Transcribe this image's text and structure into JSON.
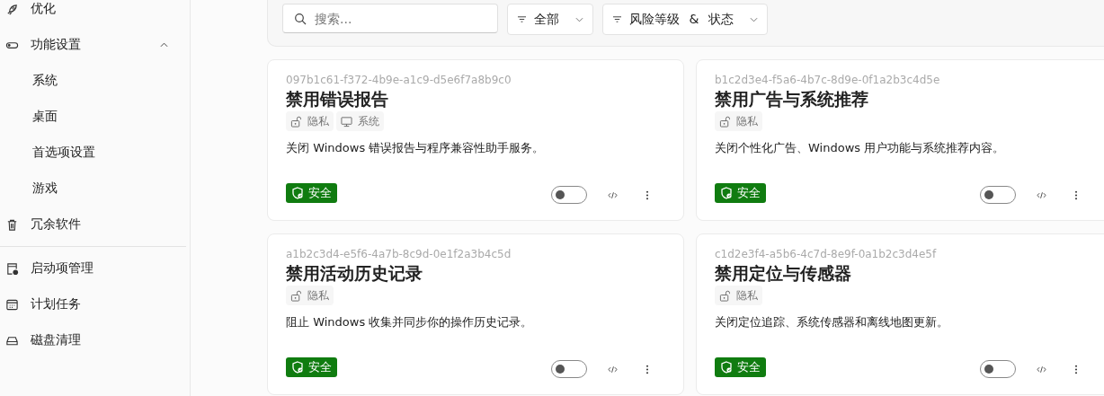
{
  "sidebar": {
    "groups": [
      [
        {
          "label": "优化"
        },
        {
          "label": "功能设置",
          "expanded": true,
          "children": [
            {
              "label": "系统"
            },
            {
              "label": "桌面"
            },
            {
              "label": "首选项设置"
            },
            {
              "label": "游戏"
            }
          ]
        },
        {
          "label": "冗余软件"
        }
      ],
      [
        {
          "label": "启动项管理"
        },
        {
          "label": "计划任务"
        },
        {
          "label": "磁盘清理"
        }
      ]
    ]
  },
  "toolbar": {
    "search": {
      "placeholder": "搜索..."
    },
    "filters": [
      "全部",
      "风险等级 & 状态"
    ]
  },
  "cards": [
    {
      "id": "097b1c61-f372-4b9e-a1c9-d5e6f7a8b9c0",
      "title": "禁用错误报告",
      "tags": [
        {
          "kind": "privacy",
          "label": "隐私"
        },
        {
          "kind": "system",
          "label": "系统"
        }
      ],
      "description": "关闭 Windows 错误报告与程序兼容性助手服务。",
      "badge": {
        "kind": "safe",
        "label": "安全"
      },
      "on": false
    },
    {
      "id": "b1c2d3e4-f5a6-4b7c-8d9e-0f1a2b3c4d5e",
      "title": "禁用广告与系统推荐",
      "tags": [
        {
          "kind": "privacy",
          "label": "隐私"
        }
      ],
      "description": "关闭个性化广告、Windows 用户功能与系统推荐内容。",
      "badge": {
        "kind": "safe",
        "label": "安全"
      },
      "on": false
    },
    {
      "id": "a1b2c3d4-e5f6-4a7b-8c9d-0e1f2a3b4c5d",
      "title": "禁用活动历史记录",
      "tags": [
        {
          "kind": "privacy",
          "label": "隐私"
        }
      ],
      "description": "阻止 Windows 收集并同步你的操作历史记录。",
      "badge": {
        "kind": "safe",
        "label": "安全"
      },
      "on": false
    },
    {
      "id": "c1d2e3f4-a5b6-4c7d-8e9f-0a1b2c3d4e5f",
      "title": "禁用定位与传感器",
      "tags": [
        {
          "kind": "privacy",
          "label": "隐私"
        }
      ],
      "description": "关闭定位追踪、系统传感器和离线地图更新。",
      "badge": {
        "kind": "safe",
        "label": "安全"
      },
      "on": false
    }
  ]
}
